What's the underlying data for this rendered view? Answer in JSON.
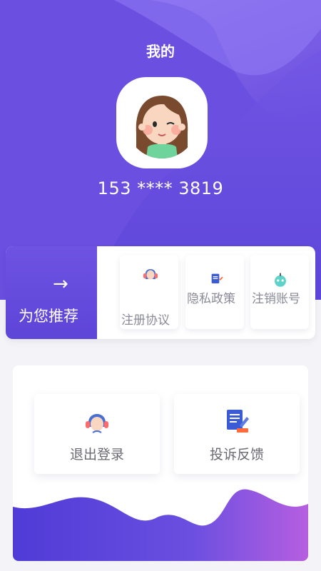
{
  "header": {
    "title": "我的",
    "phone": "153 **** 3819"
  },
  "recommend": {
    "label": "为您推荐",
    "arrow_icon": "arrow-right-icon",
    "items": [
      {
        "label": "注册协议",
        "icon": "agent-icon"
      },
      {
        "label": "隐私政策",
        "icon": "document-edit-icon"
      },
      {
        "label": "注销账号",
        "icon": "robot-icon"
      }
    ]
  },
  "actions": [
    {
      "label": "退出登录",
      "icon": "customer-service-icon"
    },
    {
      "label": "投诉反馈",
      "icon": "feedback-document-icon"
    }
  ],
  "colors": {
    "primary": "#6a4fe0",
    "accent_orange": "#ff6b3d",
    "wave_end": "#b65ee0"
  }
}
